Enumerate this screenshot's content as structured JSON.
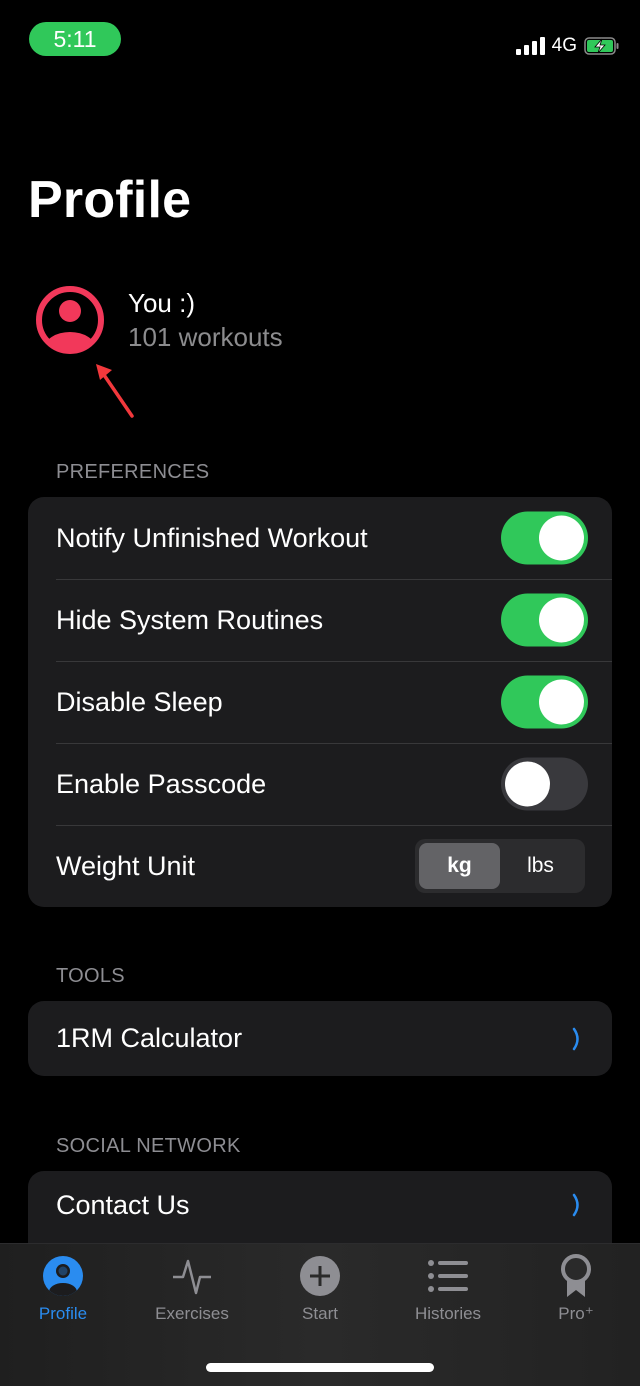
{
  "status_bar": {
    "time": "5:11",
    "network": "4G",
    "signal_icon": "signal-bars-icon",
    "battery_icon": "battery-charging-icon",
    "time_pill_color": "#30c85a"
  },
  "page": {
    "title": "Profile"
  },
  "profile": {
    "name": "You :)",
    "subtitle": "101 workouts",
    "avatar_icon": "person-circle-icon",
    "avatar_color": "#f2385a",
    "annotation_icon": "red-arrow-icon"
  },
  "sections": {
    "preferences": {
      "label": "PREFERENCES",
      "rows": [
        {
          "label": "Notify Unfinished Workout",
          "type": "toggle",
          "on": true
        },
        {
          "label": "Hide System Routines",
          "type": "toggle",
          "on": true
        },
        {
          "label": "Disable Sleep",
          "type": "toggle",
          "on": true
        },
        {
          "label": "Enable Passcode",
          "type": "toggle",
          "on": false
        },
        {
          "label": "Weight Unit",
          "type": "segmented",
          "options": [
            "kg",
            "lbs"
          ],
          "selected": "kg"
        }
      ]
    },
    "tools": {
      "label": "TOOLS",
      "rows": [
        {
          "label": "1RM Calculator",
          "type": "link"
        }
      ]
    },
    "social": {
      "label": "SOCIAL NETWORK",
      "rows": [
        {
          "label": "Contact Us",
          "type": "link"
        }
      ]
    }
  },
  "tabbar": {
    "active": "Profile",
    "accent_color": "#2a8cf0",
    "tabs": [
      {
        "label": "Profile",
        "icon": "person-circle-icon"
      },
      {
        "label": "Exercises",
        "icon": "heartbeat-icon"
      },
      {
        "label": "Start",
        "icon": "plus-circle-icon"
      },
      {
        "label": "Histories",
        "icon": "list-icon"
      },
      {
        "label": "Pro⁺",
        "icon": "award-ribbon-icon"
      }
    ]
  },
  "colors": {
    "toggle_on": "#30c85a",
    "toggle_off": "#39393d",
    "card_bg": "#1c1c1e",
    "chevron": "#2a8cf0"
  }
}
